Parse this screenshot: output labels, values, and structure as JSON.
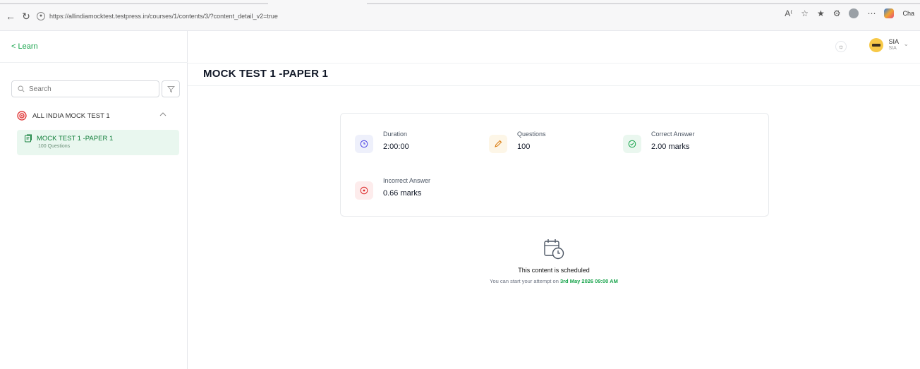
{
  "browser": {
    "url": "https://allindiamocktest.testpress.in/courses/1/contents/3/?content_detail_v2=true",
    "profile_short": "Cha"
  },
  "sidebar": {
    "back_label": "< Learn",
    "search_placeholder": "Search",
    "section": {
      "label": "ALL INDIA MOCK TEST 1"
    },
    "items": [
      {
        "title": "MOCK TEST 1 -PAPER 1",
        "subtitle": "100 Questions"
      }
    ]
  },
  "header": {
    "user_name": "SIA",
    "user_sub": "SIA"
  },
  "main": {
    "title": "MOCK TEST 1 -PAPER 1",
    "stats": [
      {
        "label": "Duration",
        "value": "2:00:00",
        "icon": "clock-icon",
        "color": "#4f46e5",
        "bg": "#eef0fb"
      },
      {
        "label": "Questions",
        "value": "100",
        "icon": "pencil-icon",
        "color": "#d97706",
        "bg": "#fdf6e7"
      },
      {
        "label": "Correct Answer",
        "value": "2.00 marks",
        "icon": "check-circle-icon",
        "color": "#16a34a",
        "bg": "#eaf7ef"
      },
      {
        "label": "Incorrect Answer",
        "value": "0.66 marks",
        "icon": "x-circle-icon",
        "color": "#dc2626",
        "bg": "#fdecec"
      }
    ],
    "schedule": {
      "title": "This content is scheduled",
      "text_prefix": "You can start your attempt on ",
      "date": "3rd May 2026 09:00 AM"
    }
  }
}
